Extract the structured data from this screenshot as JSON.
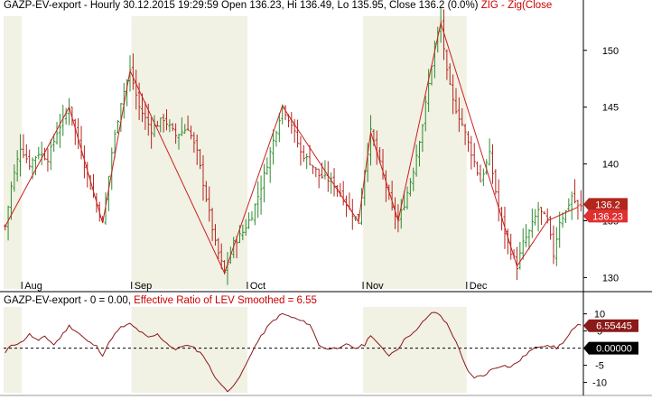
{
  "colors": {
    "background": "#ffffff",
    "shade_band": "#f1f1e4",
    "bar_up": "#2e8b2e",
    "bar_down": "#b3261e",
    "zigzag": "#cc1f1f",
    "oscillator": "#8b1a1a",
    "zero_line": "#000000",
    "price_label_bg": "#b3261e",
    "zig_label_bg": "#e03030",
    "osc_label_bg": "#8b1a1a",
    "zero_label_bg": "#000000"
  },
  "price_header": {
    "symbol": "GAZP-EV-export",
    "text": " - Hourly 30.12.2015 19:29:59 Open 136.23, Hi 136.49, Lo 135.95, Close 136.2 (0.0%)",
    "zig_text": " ZIG - Zig(Close"
  },
  "osc_header": {
    "text": "GAZP-EV-export - 0 = 0.00,",
    "indicator_text": " Effective Ratio of LEV Smoothed = 6.55"
  },
  "chart_data": [
    {
      "type": "line",
      "title": "GAZP-EV-export - Hourly 30.12.2015 19:29:59",
      "x_labels": [
        "Aug",
        "Sep",
        "Oct",
        "Nov",
        "Dec"
      ],
      "x_label_index": [
        6,
        42,
        80,
        118,
        152
      ],
      "x_count": 190,
      "ylim": [
        129,
        153
      ],
      "y_ticks": [
        130,
        135,
        140,
        145,
        150
      ],
      "last_price_label": "136.2",
      "zig_label": "136.23",
      "zigzag_points": [
        [
          0,
          134.5
        ],
        [
          21,
          145.0
        ],
        [
          32,
          134.8
        ],
        [
          41,
          148.2
        ],
        [
          72,
          130.4
        ],
        [
          91,
          145.1
        ],
        [
          116,
          134.9
        ],
        [
          120,
          142.8
        ],
        [
          129,
          135.0
        ],
        [
          143,
          152.4
        ],
        [
          168,
          131.0
        ],
        [
          178,
          135.0
        ],
        [
          188,
          136.2
        ]
      ],
      "series": [
        {
          "name": "GAZP-EV-export",
          "anchors": [
            [
              0,
              134.5
            ],
            [
              2,
              138.0
            ],
            [
              5,
              141.5
            ],
            [
              8,
              140.0
            ],
            [
              11,
              141.0
            ],
            [
              14,
              140.5
            ],
            [
              17,
              142.8
            ],
            [
              21,
              145.0
            ],
            [
              24,
              142.0
            ],
            [
              28,
              138.0
            ],
            [
              32,
              134.8
            ],
            [
              35,
              141.0
            ],
            [
              38,
              145.5
            ],
            [
              41,
              148.2
            ],
            [
              44,
              145.0
            ],
            [
              48,
              143.0
            ],
            [
              52,
              144.0
            ],
            [
              56,
              142.5
            ],
            [
              60,
              143.2
            ],
            [
              63,
              141.0
            ],
            [
              66,
              137.0
            ],
            [
              69,
              133.0
            ],
            [
              72,
              130.4
            ],
            [
              75,
              133.0
            ],
            [
              78,
              134.0
            ],
            [
              81,
              135.5
            ],
            [
              84,
              138.0
            ],
            [
              87,
              141.0
            ],
            [
              91,
              145.1
            ],
            [
              94,
              143.5
            ],
            [
              97,
              141.0
            ],
            [
              100,
              140.2
            ],
            [
              103,
              139.0
            ],
            [
              107,
              138.5
            ],
            [
              110,
              137.5
            ],
            [
              113,
              136.0
            ],
            [
              116,
              134.9
            ],
            [
              118,
              139.5
            ],
            [
              120,
              142.8
            ],
            [
              122,
              141.0
            ],
            [
              125,
              138.0
            ],
            [
              127,
              136.0
            ],
            [
              129,
              135.0
            ],
            [
              131,
              136.5
            ],
            [
              134,
              139.5
            ],
            [
              137,
              143.5
            ],
            [
              139,
              147.0
            ],
            [
              141,
              150.5
            ],
            [
              143,
              152.4
            ],
            [
              145,
              148.0
            ],
            [
              147,
              145.5
            ],
            [
              150,
              143.5
            ],
            [
              153,
              141.0
            ],
            [
              156,
              138.5
            ],
            [
              159,
              140.8
            ],
            [
              162,
              136.0
            ],
            [
              165,
              133.0
            ],
            [
              168,
              131.0
            ],
            [
              170,
              133.0
            ],
            [
              172,
              134.0
            ],
            [
              175,
              136.0
            ],
            [
              178,
              135.0
            ],
            [
              180,
              132.0
            ],
            [
              182,
              135.0
            ],
            [
              184,
              135.8
            ],
            [
              186,
              137.2
            ],
            [
              188,
              136.2
            ]
          ]
        }
      ]
    },
    {
      "type": "line",
      "title": "Effective Ratio of LEV Smoothed",
      "ylim": [
        -13,
        12
      ],
      "y_ticks": [
        -10,
        -5,
        0,
        5,
        10
      ],
      "y_tick_labels": [
        "-10",
        "-5",
        "",
        "5",
        "10"
      ],
      "zero_line": 0,
      "value_label": "6.55445",
      "zero_label": "0.00000",
      "series": [
        {
          "name": "Effective Ratio of LEV Smoothed",
          "anchors": [
            [
              0,
              -1.5
            ],
            [
              2,
              1.0
            ],
            [
              5,
              1.5
            ],
            [
              8,
              4.0
            ],
            [
              11,
              2.0
            ],
            [
              13,
              3.5
            ],
            [
              16,
              1.0
            ],
            [
              18,
              3.0
            ],
            [
              21,
              6.5
            ],
            [
              24,
              4.5
            ],
            [
              27,
              2.0
            ],
            [
              30,
              0.5
            ],
            [
              32,
              -2.0
            ],
            [
              35,
              3.0
            ],
            [
              38,
              6.0
            ],
            [
              41,
              7.0
            ],
            [
              44,
              5.0
            ],
            [
              47,
              3.0
            ],
            [
              50,
              4.0
            ],
            [
              53,
              1.5
            ],
            [
              56,
              -0.5
            ],
            [
              59,
              1.0
            ],
            [
              62,
              0.0
            ],
            [
              65,
              -2.0
            ],
            [
              68,
              -7.0
            ],
            [
              71,
              -11.0
            ],
            [
              73,
              -12.3
            ],
            [
              76,
              -10.0
            ],
            [
              79,
              -5.0
            ],
            [
              81,
              -1.0
            ],
            [
              83,
              2.0
            ],
            [
              86,
              6.0
            ],
            [
              88,
              8.0
            ],
            [
              91,
              10.0
            ],
            [
              94,
              9.0
            ],
            [
              97,
              8.0
            ],
            [
              100,
              7.0
            ],
            [
              103,
              1.0
            ],
            [
              106,
              -0.5
            ],
            [
              108,
              0.5
            ],
            [
              110,
              -0.2
            ],
            [
              112,
              1.0
            ],
            [
              115,
              0.0
            ],
            [
              118,
              1.0
            ],
            [
              120,
              4.0
            ],
            [
              123,
              0.5
            ],
            [
              126,
              -2.0
            ],
            [
              129,
              0.0
            ],
            [
              132,
              3.5
            ],
            [
              135,
              5.0
            ],
            [
              137,
              7.5
            ],
            [
              139,
              9.5
            ],
            [
              141,
              10.5
            ],
            [
              143,
              9.5
            ],
            [
              145,
              7.0
            ],
            [
              148,
              2.0
            ],
            [
              150,
              -3.0
            ],
            [
              152,
              -7.0
            ],
            [
              154,
              -8.5
            ],
            [
              157,
              -8.0
            ],
            [
              160,
              -6.0
            ],
            [
              163,
              -5.0
            ],
            [
              166,
              -5.5
            ],
            [
              169,
              -3.5
            ],
            [
              172,
              -1.0
            ],
            [
              175,
              0.5
            ],
            [
              178,
              1.0
            ],
            [
              181,
              0.0
            ],
            [
              184,
              2.5
            ],
            [
              186,
              5.0
            ],
            [
              188,
              6.55
            ]
          ]
        }
      ]
    }
  ]
}
